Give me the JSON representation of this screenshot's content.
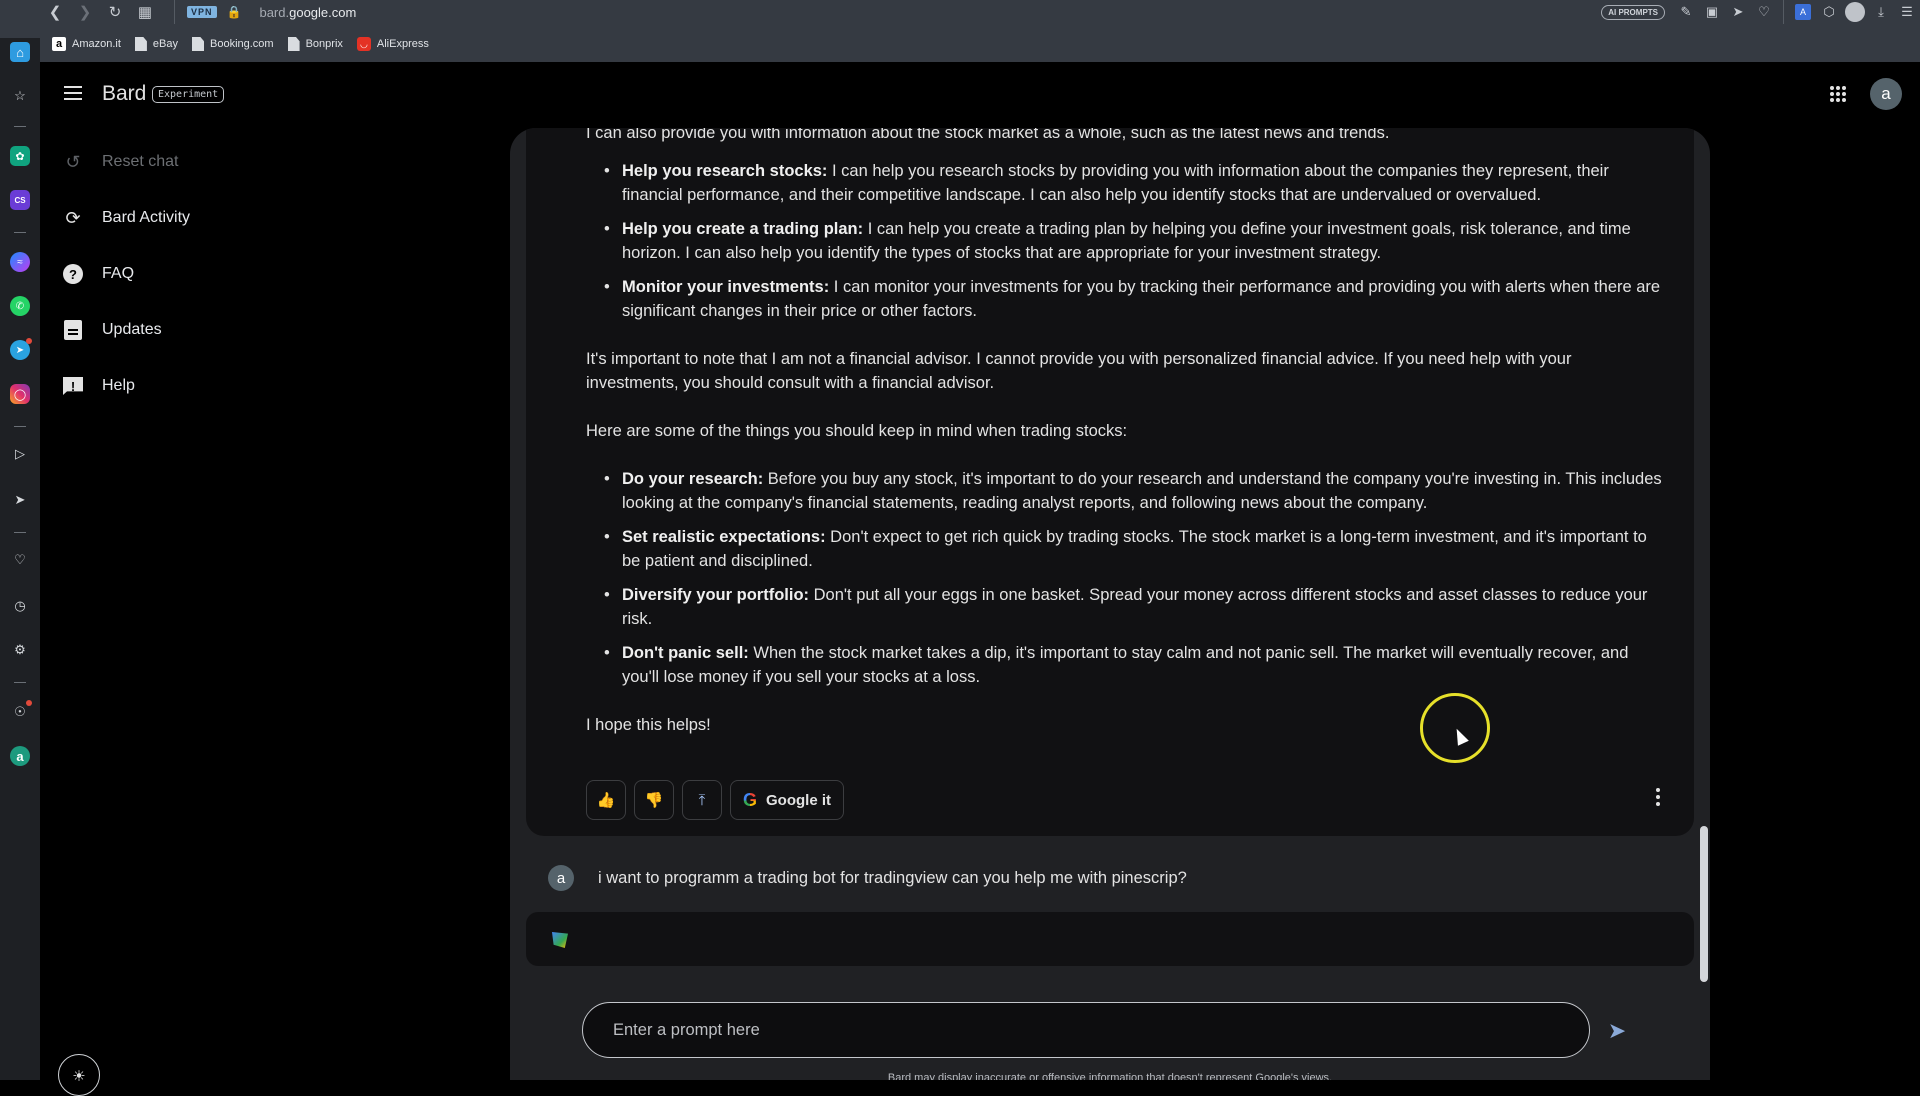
{
  "browser": {
    "vpn_label": "VPN",
    "url_sub": "bard.",
    "url_domain": "google.com",
    "ai_prompts_label": "AI PROMPTS",
    "bookmarks": [
      {
        "label": "Amazon.it",
        "icon": "amazon-icon"
      },
      {
        "label": "eBay",
        "icon": "page-icon"
      },
      {
        "label": "Booking.com",
        "icon": "page-icon"
      },
      {
        "label": "Bonprix",
        "icon": "page-icon"
      },
      {
        "label": "AliExpress",
        "icon": "aliexpress-icon"
      }
    ],
    "toolbar_icons": [
      "edit-icon",
      "camera-icon",
      "send-icon",
      "heart-icon",
      "translate-icon",
      "cube-icon",
      "profile-icon",
      "download-icon",
      "settings-icon"
    ],
    "appbar_icons": [
      "home-icon",
      "star-icon",
      "chatgpt-icon",
      "cs-icon",
      "messenger-icon",
      "whatsapp-icon",
      "telegram-icon",
      "instagram-icon",
      "play-icon",
      "send-icon",
      "heart-icon",
      "history-icon",
      "settings-icon",
      "lightbulb-icon",
      "account-icon"
    ]
  },
  "sidebar": {
    "title": "Bard",
    "badge": "Experiment",
    "items": [
      {
        "label": "Reset chat",
        "icon": "reset-icon",
        "disabled": true
      },
      {
        "label": "Bard Activity",
        "icon": "history-icon",
        "disabled": false
      },
      {
        "label": "FAQ",
        "icon": "question-icon",
        "disabled": false
      },
      {
        "label": "Updates",
        "icon": "calendar-icon",
        "disabled": false
      },
      {
        "label": "Help",
        "icon": "feedback-icon",
        "disabled": false
      }
    ]
  },
  "header": {
    "avatar_letter": "a"
  },
  "response": {
    "partial_top": "I can also provide you with information about the stock market as a whole, such as the latest news and trends.",
    "bullets1": [
      {
        "title": "Help you research stocks:",
        "text": " I can help you research stocks by providing you with information about the companies they represent, their financial performance, and their competitive landscape. I can also help you identify stocks that are undervalued or overvalued."
      },
      {
        "title": "Help you create a trading plan:",
        "text": " I can help you create a trading plan by helping you define your investment goals, risk tolerance, and time horizon. I can also help you identify the types of stocks that are appropriate for your investment strategy."
      },
      {
        "title": "Monitor your investments:",
        "text": " I can monitor your investments for you by tracking their performance and providing you with alerts when there are significant changes in their price or other factors."
      }
    ],
    "para1": "It's important to note that I am not a financial advisor. I cannot provide you with personalized financial advice. If you need help with your investments, you should consult with a financial advisor.",
    "para2": "Here are some of the things you should keep in mind when trading stocks:",
    "bullets2": [
      {
        "title": "Do your research:",
        "text": " Before you buy any stock, it's important to do your research and understand the company you're investing in. This includes looking at the company's financial statements, reading analyst reports, and following news about the company."
      },
      {
        "title": "Set realistic expectations:",
        "text": " Don't expect to get rich quick by trading stocks. The stock market is a long-term investment, and it's important to be patient and disciplined."
      },
      {
        "title": "Diversify your portfolio:",
        "text": " Don't put all your eggs in one basket. Spread your money across different stocks and asset classes to reduce your risk."
      },
      {
        "title": "Don't panic sell:",
        "text": " When the stock market takes a dip, it's important to stay calm and not panic sell. The market will eventually recover, and you'll lose money if you sell your stocks at a loss."
      }
    ],
    "closing": "I hope this helps!",
    "google_it_label": "Google it"
  },
  "user_message": {
    "avatar_letter": "a",
    "text": "i want to programm a trading bot for tradingview can you help me with pinescrip?"
  },
  "prompt": {
    "placeholder": "Enter a prompt here",
    "value": ""
  },
  "disclaimer": "Bard may display inaccurate or offensive information that doesn't represent Google's views."
}
